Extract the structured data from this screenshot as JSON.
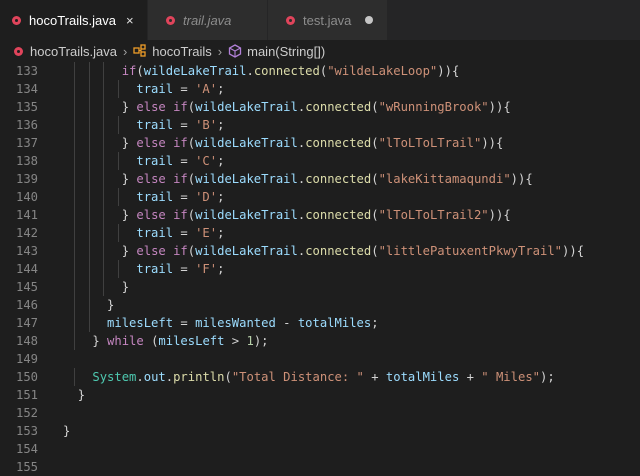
{
  "tabs": [
    {
      "label": "hocoTrails.java",
      "active": true,
      "close": "×"
    },
    {
      "label": "trail.java",
      "italic": true
    },
    {
      "label": "test.java",
      "modified": true
    }
  ],
  "breadcrumb": {
    "file": "hocoTrails.java",
    "class": "hocoTrails",
    "method": "main(String[])"
  },
  "editor": {
    "lines": [
      {
        "n": "133",
        "indent": 4,
        "tokens": [
          [
            "kw",
            "if"
          ],
          [
            "tx",
            "("
          ],
          [
            "var",
            "wildeLakeTrail"
          ],
          [
            "tx",
            "."
          ],
          [
            "fn",
            "connected"
          ],
          [
            "tx",
            "("
          ],
          [
            "str",
            "\"wildeLakeLoop\""
          ],
          [
            "tx",
            "))"
          ],
          [
            "tx",
            "{"
          ]
        ]
      },
      {
        "n": "134",
        "indent": 5,
        "tokens": [
          [
            "var",
            "trail"
          ],
          [
            "tx",
            " = "
          ],
          [
            "str",
            "'A'"
          ],
          [
            "tx",
            ";"
          ]
        ]
      },
      {
        "n": "135",
        "indent": 4,
        "tokens": [
          [
            "tx",
            "} "
          ],
          [
            "kw",
            "else if"
          ],
          [
            "tx",
            "("
          ],
          [
            "var",
            "wildeLakeTrail"
          ],
          [
            "tx",
            "."
          ],
          [
            "fn",
            "connected"
          ],
          [
            "tx",
            "("
          ],
          [
            "str",
            "\"wRunningBrook\""
          ],
          [
            "tx",
            "))"
          ],
          [
            "tx",
            "{"
          ]
        ]
      },
      {
        "n": "136",
        "indent": 5,
        "tokens": [
          [
            "var",
            "trail"
          ],
          [
            "tx",
            " = "
          ],
          [
            "str",
            "'B'"
          ],
          [
            "tx",
            ";"
          ]
        ]
      },
      {
        "n": "137",
        "indent": 4,
        "tokens": [
          [
            "tx",
            "} "
          ],
          [
            "kw",
            "else if"
          ],
          [
            "tx",
            "("
          ],
          [
            "var",
            "wildeLakeTrail"
          ],
          [
            "tx",
            "."
          ],
          [
            "fn",
            "connected"
          ],
          [
            "tx",
            "("
          ],
          [
            "str",
            "\"lToLToLTrail\""
          ],
          [
            "tx",
            "))"
          ],
          [
            "tx",
            "{"
          ]
        ]
      },
      {
        "n": "138",
        "indent": 5,
        "tokens": [
          [
            "var",
            "trail"
          ],
          [
            "tx",
            " = "
          ],
          [
            "str",
            "'C'"
          ],
          [
            "tx",
            ";"
          ]
        ]
      },
      {
        "n": "139",
        "indent": 4,
        "tokens": [
          [
            "tx",
            "} "
          ],
          [
            "kw",
            "else if"
          ],
          [
            "tx",
            "("
          ],
          [
            "var",
            "wildeLakeTrail"
          ],
          [
            "tx",
            "."
          ],
          [
            "fn",
            "connected"
          ],
          [
            "tx",
            "("
          ],
          [
            "str",
            "\"lakeKittamaqundi\""
          ],
          [
            "tx",
            "))"
          ],
          [
            "tx",
            "{"
          ]
        ]
      },
      {
        "n": "140",
        "indent": 5,
        "tokens": [
          [
            "var",
            "trail"
          ],
          [
            "tx",
            " = "
          ],
          [
            "str",
            "'D'"
          ],
          [
            "tx",
            ";"
          ]
        ]
      },
      {
        "n": "141",
        "indent": 4,
        "tokens": [
          [
            "tx",
            "} "
          ],
          [
            "kw",
            "else if"
          ],
          [
            "tx",
            "("
          ],
          [
            "var",
            "wildeLakeTrail"
          ],
          [
            "tx",
            "."
          ],
          [
            "fn",
            "connected"
          ],
          [
            "tx",
            "("
          ],
          [
            "str",
            "\"lToLToLTrail2\""
          ],
          [
            "tx",
            "))"
          ],
          [
            "tx",
            "{"
          ]
        ]
      },
      {
        "n": "142",
        "indent": 5,
        "tokens": [
          [
            "var",
            "trail"
          ],
          [
            "tx",
            " = "
          ],
          [
            "str",
            "'E'"
          ],
          [
            "tx",
            ";"
          ]
        ]
      },
      {
        "n": "143",
        "indent": 4,
        "tokens": [
          [
            "tx",
            "} "
          ],
          [
            "kw",
            "else if"
          ],
          [
            "tx",
            "("
          ],
          [
            "var",
            "wildeLakeTrail"
          ],
          [
            "tx",
            "."
          ],
          [
            "fn",
            "connected"
          ],
          [
            "tx",
            "("
          ],
          [
            "str",
            "\"littlePatuxentPkwyTrail\""
          ],
          [
            "tx",
            "))"
          ],
          [
            "tx",
            "{"
          ]
        ]
      },
      {
        "n": "144",
        "indent": 5,
        "tokens": [
          [
            "var",
            "trail"
          ],
          [
            "tx",
            " = "
          ],
          [
            "str",
            "'F'"
          ],
          [
            "tx",
            ";"
          ]
        ]
      },
      {
        "n": "145",
        "indent": 4,
        "tokens": [
          [
            "tx",
            "}"
          ]
        ]
      },
      {
        "n": "146",
        "indent": 3,
        "tokens": [
          [
            "tx",
            "}"
          ]
        ]
      },
      {
        "n": "147",
        "indent": 3,
        "tokens": [
          [
            "var",
            "milesLeft"
          ],
          [
            "tx",
            " = "
          ],
          [
            "var",
            "milesWanted"
          ],
          [
            "tx",
            " - "
          ],
          [
            "var",
            "totalMiles"
          ],
          [
            "tx",
            ";"
          ]
        ]
      },
      {
        "n": "148",
        "indent": 2,
        "tokens": [
          [
            "tx",
            "} "
          ],
          [
            "kw",
            "while"
          ],
          [
            "tx",
            " ("
          ],
          [
            "var",
            "milesLeft"
          ],
          [
            "tx",
            " > "
          ],
          [
            "num",
            "1"
          ],
          [
            "tx",
            ");"
          ]
        ]
      },
      {
        "n": "149",
        "indent": 0,
        "tokens": []
      },
      {
        "n": "150",
        "indent": 2,
        "tokens": [
          [
            "cls",
            "System"
          ],
          [
            "tx",
            "."
          ],
          [
            "var",
            "out"
          ],
          [
            "tx",
            "."
          ],
          [
            "fn",
            "println"
          ],
          [
            "tx",
            "("
          ],
          [
            "str",
            "\"Total Distance: \""
          ],
          [
            "tx",
            " + "
          ],
          [
            "var",
            "totalMiles"
          ],
          [
            "tx",
            " + "
          ],
          [
            "str",
            "\" Miles\""
          ],
          [
            "tx",
            ");"
          ]
        ]
      },
      {
        "n": "151",
        "indent": 1,
        "tokens": [
          [
            "tx",
            "}"
          ]
        ]
      },
      {
        "n": "152",
        "indent": 0,
        "tokens": []
      },
      {
        "n": "153",
        "indent": 0,
        "tokens": [
          [
            "tx",
            "}"
          ]
        ]
      },
      {
        "n": "154",
        "indent": 0,
        "tokens": []
      },
      {
        "n": "155",
        "indent": 0,
        "tokens": []
      }
    ]
  }
}
